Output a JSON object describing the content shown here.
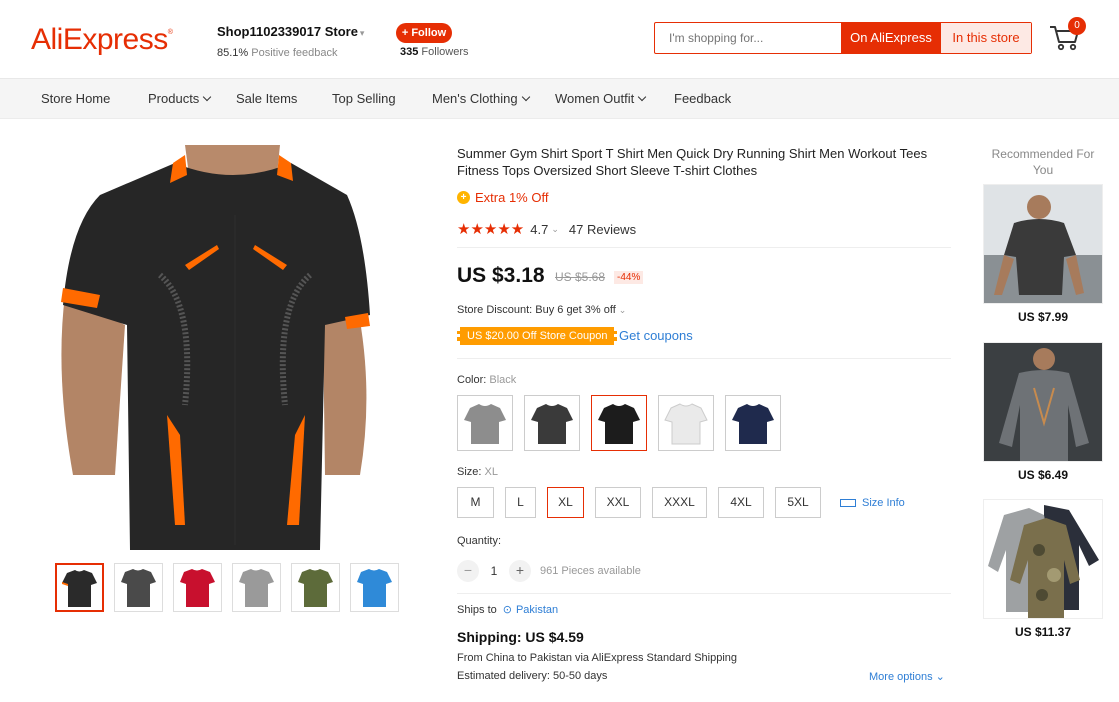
{
  "header": {
    "logo": "AliExpress",
    "store_name": "Shop1102339017 Store",
    "feedback_pct": "85.1%",
    "feedback_label": "Positive feedback",
    "follow_label": "+ Follow",
    "followers_count": "335",
    "followers_label": "Followers",
    "search_placeholder": "I'm shopping for...",
    "search_on": "On AliExpress",
    "search_in": "In this store",
    "cart_count": "0",
    "icons": {
      "cart": "cart-icon"
    }
  },
  "nav": {
    "items": [
      "Store Home",
      "Products",
      "Sale Items",
      "Top Selling",
      "Men's Clothing",
      "Women Outfit",
      "Feedback"
    ]
  },
  "product": {
    "title": "Summer Gym Shirt Sport T Shirt Men Quick Dry Running Shirt Men Workout Tees Fitness Tops Oversized Short Sleeve T-shirt Clothes",
    "extra_off": "Extra 1% Off",
    "rating": "4.7",
    "reviews": "47 Reviews",
    "price": "US $3.18",
    "old_price": "US $5.68",
    "discount": "-44%",
    "store_discount": "Store Discount: Buy 6 get 3% off",
    "coupon": "US $20.00 Off Store Coupon",
    "get_coupons": "Get coupons",
    "color_label": "Color:",
    "color_value": "Black",
    "colors": [
      "gray",
      "charcoal",
      "black",
      "white",
      "navy"
    ],
    "colors_hex": [
      "#8d8d8d",
      "#3a3a3a",
      "#1c1c1c",
      "#eaeaea",
      "#1f2a4d"
    ],
    "size_label": "Size:",
    "size_value": "XL",
    "sizes": [
      "M",
      "L",
      "XL",
      "XXL",
      "XXXL",
      "4XL",
      "5XL"
    ],
    "size_info": "Size Info",
    "quantity_label": "Quantity:",
    "quantity": "1",
    "available": "961 Pieces available",
    "ships_to_label": "Ships to",
    "ships_to_country": "Pakistan",
    "shipping": "Shipping: US $4.59",
    "ship_from": "From China to Pakistan via AliExpress Standard Shipping",
    "estimated": "Estimated delivery: 50-50 days",
    "more_options": "More options",
    "thumb_colors": [
      "#2a2a2a",
      "#4a4a4a",
      "#c8102e",
      "#9a9a9a",
      "#5d6b3a",
      "#2f8ad8"
    ]
  },
  "recommended": {
    "title": "Recommended For You",
    "items": [
      {
        "price": "US $7.99"
      },
      {
        "price": "US $6.49"
      },
      {
        "price": "US $11.37"
      }
    ]
  },
  "colors": {
    "brand": "#e62e04",
    "accent_orange": "#ff6a00",
    "link": "#2e7ed5"
  }
}
